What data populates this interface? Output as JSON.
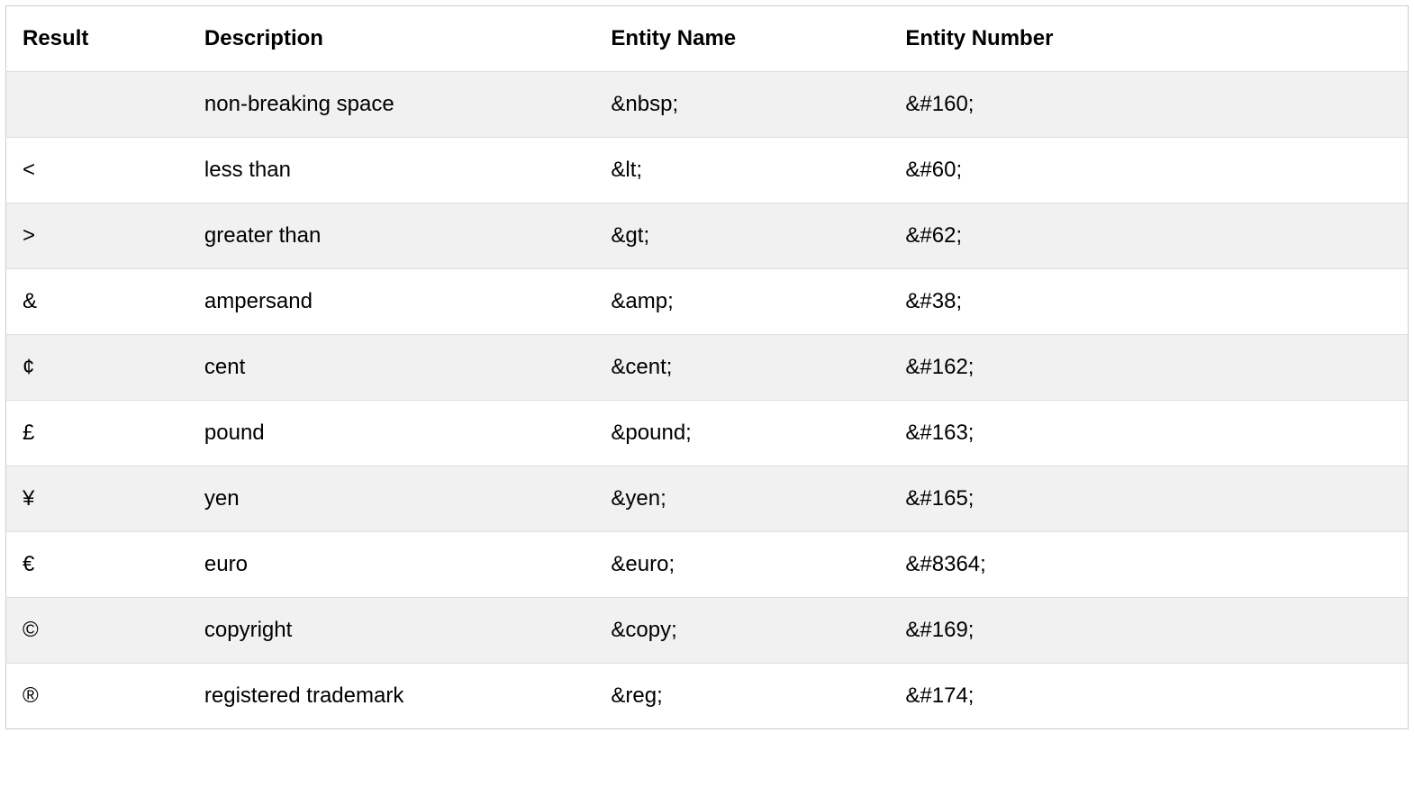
{
  "table": {
    "headers": {
      "result": "Result",
      "description": "Description",
      "entity_name": "Entity Name",
      "entity_number": "Entity Number"
    },
    "rows": [
      {
        "result": " ",
        "description": "non-breaking space",
        "entity_name": "&nbsp;",
        "entity_number": "&#160;"
      },
      {
        "result": "<",
        "description": "less than",
        "entity_name": "&lt;",
        "entity_number": "&#60;"
      },
      {
        "result": ">",
        "description": "greater than",
        "entity_name": "&gt;",
        "entity_number": "&#62;"
      },
      {
        "result": "&",
        "description": "ampersand",
        "entity_name": "&amp;",
        "entity_number": "&#38;"
      },
      {
        "result": "¢",
        "description": "cent",
        "entity_name": "&cent;",
        "entity_number": "&#162;"
      },
      {
        "result": "£",
        "description": "pound",
        "entity_name": "&pound;",
        "entity_number": "&#163;"
      },
      {
        "result": "¥",
        "description": "yen",
        "entity_name": "&yen;",
        "entity_number": "&#165;"
      },
      {
        "result": "€",
        "description": "euro",
        "entity_name": "&euro;",
        "entity_number": "&#8364;"
      },
      {
        "result": "©",
        "description": "copyright",
        "entity_name": "&copy;",
        "entity_number": "&#169;"
      },
      {
        "result": "®",
        "description": "registered trademark",
        "entity_name": "&reg;",
        "entity_number": "&#174;"
      }
    ]
  }
}
